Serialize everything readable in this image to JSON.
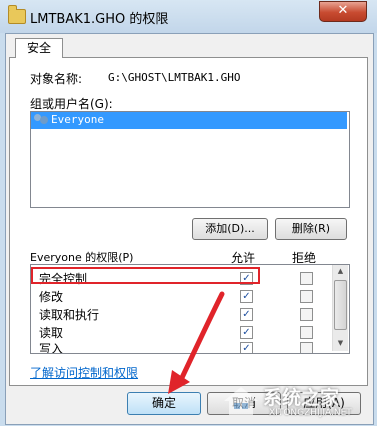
{
  "window": {
    "title": "LMTBAK1.GHO 的权限",
    "close_label": "✕"
  },
  "tabs": [
    {
      "label": "安全"
    }
  ],
  "object": {
    "label": "对象名称:",
    "value": "G:\\GHOST\\LMTBAK1.GHO"
  },
  "groups": {
    "label": "组或用户名(G):",
    "items": [
      {
        "name": "Everyone",
        "selected": true
      }
    ],
    "add_label": "添加(D)...",
    "remove_label": "删除(R)"
  },
  "permissions": {
    "title": "Everyone 的权限(P)",
    "allow_header": "允许",
    "deny_header": "拒绝",
    "rows": [
      {
        "name": "完全控制",
        "allow": true,
        "deny": false
      },
      {
        "name": "修改",
        "allow": true,
        "deny": false
      },
      {
        "name": "读取和执行",
        "allow": true,
        "deny": false
      },
      {
        "name": "读取",
        "allow": true,
        "deny": false
      },
      {
        "name": "写入",
        "allow": true,
        "deny": false
      }
    ],
    "highlight_color": "#e0242a"
  },
  "link": "了解访问控制和权限",
  "buttons": {
    "ok": "确定",
    "cancel": "取消",
    "apply": "应用(A)"
  },
  "watermark": {
    "text": "系统之家",
    "url": "XITONGZHIJIA.NET"
  }
}
